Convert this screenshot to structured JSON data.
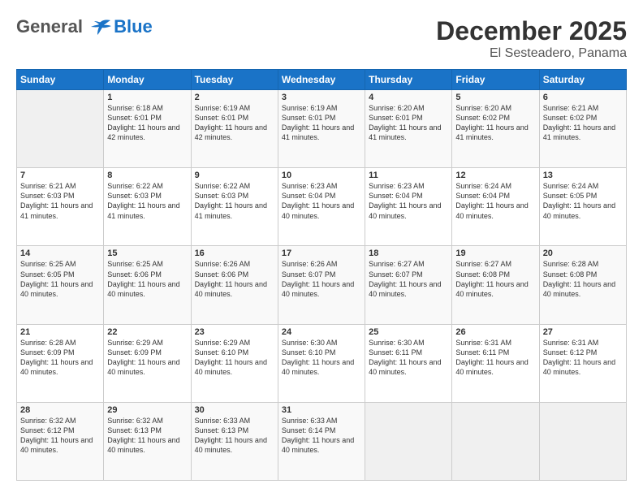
{
  "logo": {
    "line1": "General",
    "line2": "Blue"
  },
  "title": "December 2025",
  "subtitle": "El Sesteadero, Panama",
  "days_header": [
    "Sunday",
    "Monday",
    "Tuesday",
    "Wednesday",
    "Thursday",
    "Friday",
    "Saturday"
  ],
  "weeks": [
    [
      {
        "day": "",
        "sunrise": "",
        "sunset": "",
        "daylight": ""
      },
      {
        "day": "1",
        "sunrise": "Sunrise: 6:18 AM",
        "sunset": "Sunset: 6:01 PM",
        "daylight": "Daylight: 11 hours and 42 minutes."
      },
      {
        "day": "2",
        "sunrise": "Sunrise: 6:19 AM",
        "sunset": "Sunset: 6:01 PM",
        "daylight": "Daylight: 11 hours and 42 minutes."
      },
      {
        "day": "3",
        "sunrise": "Sunrise: 6:19 AM",
        "sunset": "Sunset: 6:01 PM",
        "daylight": "Daylight: 11 hours and 41 minutes."
      },
      {
        "day": "4",
        "sunrise": "Sunrise: 6:20 AM",
        "sunset": "Sunset: 6:01 PM",
        "daylight": "Daylight: 11 hours and 41 minutes."
      },
      {
        "day": "5",
        "sunrise": "Sunrise: 6:20 AM",
        "sunset": "Sunset: 6:02 PM",
        "daylight": "Daylight: 11 hours and 41 minutes."
      },
      {
        "day": "6",
        "sunrise": "Sunrise: 6:21 AM",
        "sunset": "Sunset: 6:02 PM",
        "daylight": "Daylight: 11 hours and 41 minutes."
      }
    ],
    [
      {
        "day": "7",
        "sunrise": "Sunrise: 6:21 AM",
        "sunset": "Sunset: 6:03 PM",
        "daylight": "Daylight: 11 hours and 41 minutes."
      },
      {
        "day": "8",
        "sunrise": "Sunrise: 6:22 AM",
        "sunset": "Sunset: 6:03 PM",
        "daylight": "Daylight: 11 hours and 41 minutes."
      },
      {
        "day": "9",
        "sunrise": "Sunrise: 6:22 AM",
        "sunset": "Sunset: 6:03 PM",
        "daylight": "Daylight: 11 hours and 41 minutes."
      },
      {
        "day": "10",
        "sunrise": "Sunrise: 6:23 AM",
        "sunset": "Sunset: 6:04 PM",
        "daylight": "Daylight: 11 hours and 40 minutes."
      },
      {
        "day": "11",
        "sunrise": "Sunrise: 6:23 AM",
        "sunset": "Sunset: 6:04 PM",
        "daylight": "Daylight: 11 hours and 40 minutes."
      },
      {
        "day": "12",
        "sunrise": "Sunrise: 6:24 AM",
        "sunset": "Sunset: 6:04 PM",
        "daylight": "Daylight: 11 hours and 40 minutes."
      },
      {
        "day": "13",
        "sunrise": "Sunrise: 6:24 AM",
        "sunset": "Sunset: 6:05 PM",
        "daylight": "Daylight: 11 hours and 40 minutes."
      }
    ],
    [
      {
        "day": "14",
        "sunrise": "Sunrise: 6:25 AM",
        "sunset": "Sunset: 6:05 PM",
        "daylight": "Daylight: 11 hours and 40 minutes."
      },
      {
        "day": "15",
        "sunrise": "Sunrise: 6:25 AM",
        "sunset": "Sunset: 6:06 PM",
        "daylight": "Daylight: 11 hours and 40 minutes."
      },
      {
        "day": "16",
        "sunrise": "Sunrise: 6:26 AM",
        "sunset": "Sunset: 6:06 PM",
        "daylight": "Daylight: 11 hours and 40 minutes."
      },
      {
        "day": "17",
        "sunrise": "Sunrise: 6:26 AM",
        "sunset": "Sunset: 6:07 PM",
        "daylight": "Daylight: 11 hours and 40 minutes."
      },
      {
        "day": "18",
        "sunrise": "Sunrise: 6:27 AM",
        "sunset": "Sunset: 6:07 PM",
        "daylight": "Daylight: 11 hours and 40 minutes."
      },
      {
        "day": "19",
        "sunrise": "Sunrise: 6:27 AM",
        "sunset": "Sunset: 6:08 PM",
        "daylight": "Daylight: 11 hours and 40 minutes."
      },
      {
        "day": "20",
        "sunrise": "Sunrise: 6:28 AM",
        "sunset": "Sunset: 6:08 PM",
        "daylight": "Daylight: 11 hours and 40 minutes."
      }
    ],
    [
      {
        "day": "21",
        "sunrise": "Sunrise: 6:28 AM",
        "sunset": "Sunset: 6:09 PM",
        "daylight": "Daylight: 11 hours and 40 minutes."
      },
      {
        "day": "22",
        "sunrise": "Sunrise: 6:29 AM",
        "sunset": "Sunset: 6:09 PM",
        "daylight": "Daylight: 11 hours and 40 minutes."
      },
      {
        "day": "23",
        "sunrise": "Sunrise: 6:29 AM",
        "sunset": "Sunset: 6:10 PM",
        "daylight": "Daylight: 11 hours and 40 minutes."
      },
      {
        "day": "24",
        "sunrise": "Sunrise: 6:30 AM",
        "sunset": "Sunset: 6:10 PM",
        "daylight": "Daylight: 11 hours and 40 minutes."
      },
      {
        "day": "25",
        "sunrise": "Sunrise: 6:30 AM",
        "sunset": "Sunset: 6:11 PM",
        "daylight": "Daylight: 11 hours and 40 minutes."
      },
      {
        "day": "26",
        "sunrise": "Sunrise: 6:31 AM",
        "sunset": "Sunset: 6:11 PM",
        "daylight": "Daylight: 11 hours and 40 minutes."
      },
      {
        "day": "27",
        "sunrise": "Sunrise: 6:31 AM",
        "sunset": "Sunset: 6:12 PM",
        "daylight": "Daylight: 11 hours and 40 minutes."
      }
    ],
    [
      {
        "day": "28",
        "sunrise": "Sunrise: 6:32 AM",
        "sunset": "Sunset: 6:12 PM",
        "daylight": "Daylight: 11 hours and 40 minutes."
      },
      {
        "day": "29",
        "sunrise": "Sunrise: 6:32 AM",
        "sunset": "Sunset: 6:13 PM",
        "daylight": "Daylight: 11 hours and 40 minutes."
      },
      {
        "day": "30",
        "sunrise": "Sunrise: 6:33 AM",
        "sunset": "Sunset: 6:13 PM",
        "daylight": "Daylight: 11 hours and 40 minutes."
      },
      {
        "day": "31",
        "sunrise": "Sunrise: 6:33 AM",
        "sunset": "Sunset: 6:14 PM",
        "daylight": "Daylight: 11 hours and 40 minutes."
      },
      {
        "day": "",
        "sunrise": "",
        "sunset": "",
        "daylight": ""
      },
      {
        "day": "",
        "sunrise": "",
        "sunset": "",
        "daylight": ""
      },
      {
        "day": "",
        "sunrise": "",
        "sunset": "",
        "daylight": ""
      }
    ]
  ]
}
